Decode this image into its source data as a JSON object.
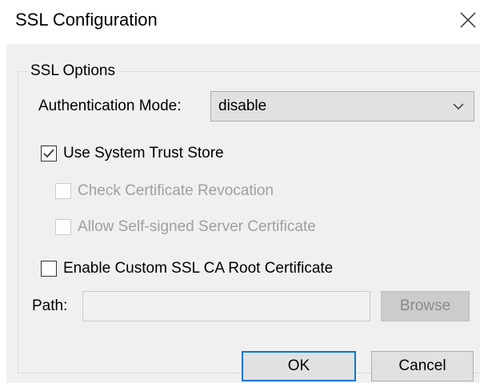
{
  "window": {
    "title": "SSL Configuration",
    "close_icon": "close-icon"
  },
  "ssl_options": {
    "group_label": "SSL Options",
    "auth_mode_label": "Authentication Mode:",
    "auth_mode_value": "disable",
    "options": [
      {
        "label": "Use System Trust Store",
        "checked": true,
        "enabled": true
      },
      {
        "label": "Check Certificate Revocation",
        "checked": false,
        "enabled": false
      },
      {
        "label": "Allow Self-signed Server Certificate",
        "checked": false,
        "enabled": false
      },
      {
        "label": "Enable Custom SSL CA Root Certificate",
        "checked": false,
        "enabled": true
      }
    ],
    "path_label": "Path:",
    "path_value": "",
    "browse_label": "Browse"
  },
  "buttons": {
    "ok_label": "OK",
    "cancel_label": "Cancel"
  },
  "colors": {
    "accent": "#0078d7",
    "dialog_background": "#f0f0f0",
    "disabled_text": "#a0a0a0"
  }
}
